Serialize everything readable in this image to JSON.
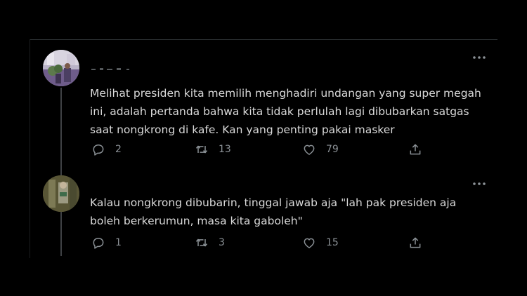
{
  "tweets": [
    {
      "text": "Melihat presiden kita memilih menghadiri undangan yang super megah ini, adalah pertanda bahwa kita tidak perlulah lagi dibubarkan satgas saat nongkrong di kafe. Kan yang penting pakai masker",
      "replies": "2",
      "retweets": "13",
      "likes": "79"
    },
    {
      "text": "Kalau nongkrong dibubarin, tinggal jawab aja \"lah pak presiden aja boleh berkerumun, masa kita gaboleh\"",
      "replies": "1",
      "retweets": "3",
      "likes": "15"
    }
  ],
  "icons": {
    "more": "more-horizontal-icon",
    "reply": "reply-icon",
    "retweet": "retweet-icon",
    "like": "heart-icon",
    "share": "share-icon"
  },
  "colors": {
    "background": "#000000",
    "text": "#d9d9d9",
    "muted": "#8b9196",
    "thread_line": "#3e4144"
  }
}
